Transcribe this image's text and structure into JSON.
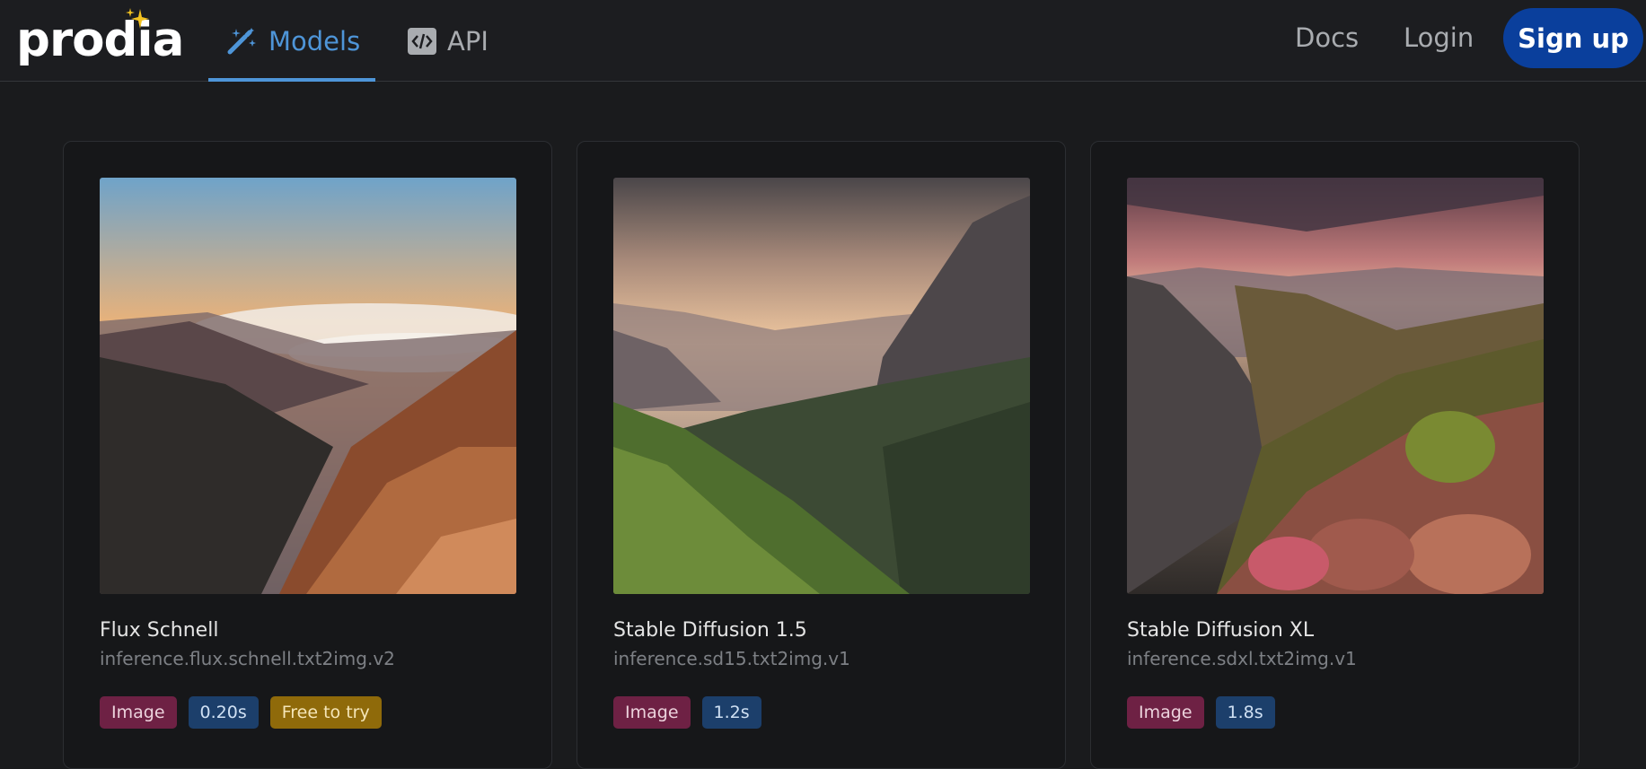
{
  "header": {
    "logo": "prodia",
    "tabs": [
      {
        "label": "Models",
        "icon": "magic-wand-icon",
        "active": true
      },
      {
        "label": "API",
        "icon": "code-icon",
        "active": false
      }
    ],
    "links": [
      "Docs",
      "Login"
    ],
    "signup_label": "Sign up",
    "accent_color": "#4e95d8",
    "signup_color": "#0a3f9c"
  },
  "models": [
    {
      "name": "Flux Schnell",
      "id": "inference.flux.schnell.txt2img.v2",
      "badges": {
        "type": "Image",
        "speed": "0.20s",
        "free": "Free to try"
      },
      "image": "mountain-sunset-clouds"
    },
    {
      "name": "Stable Diffusion 1.5",
      "id": "inference.sd15.txt2img.v1",
      "badges": {
        "type": "Image",
        "speed": "1.2s"
      },
      "image": "misty-mountain-valley"
    },
    {
      "name": "Stable Diffusion XL",
      "id": "inference.sdxl.txt2img.v1",
      "badges": {
        "type": "Image",
        "speed": "1.8s"
      },
      "image": "rocky-peak-sunrise"
    }
  ]
}
